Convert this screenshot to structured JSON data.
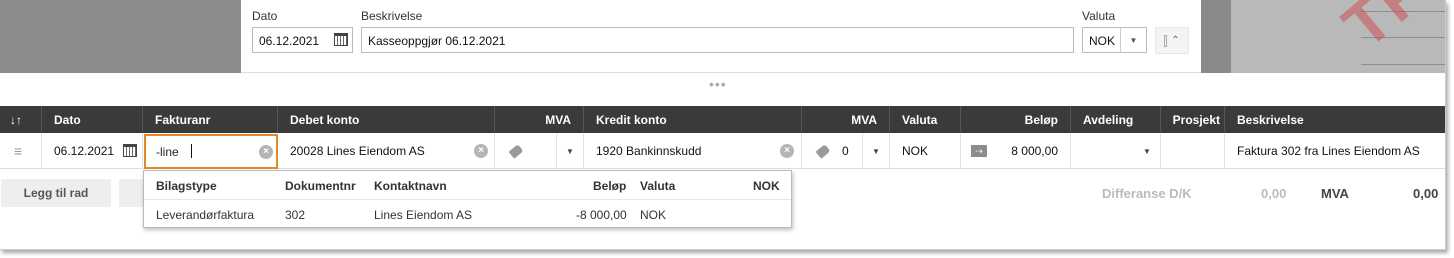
{
  "header_form": {
    "date_label": "Dato",
    "date_value": "06.12.2021",
    "description_label": "Beskrivelse",
    "description_value": "Kasseoppgjør 06.12.2021",
    "currency_label": "Valuta",
    "currency_value": "NOK"
  },
  "grid": {
    "columns": {
      "sort": "↓↑",
      "date": "Dato",
      "invoice": "Fakturanr",
      "debit_account": "Debet konto",
      "debit_vat": "MVA",
      "credit_account": "Kredit konto",
      "credit_vat": "MVA",
      "currency": "Valuta",
      "amount": "Beløp",
      "department": "Avdeling",
      "project": "Prosjekt",
      "description": "Beskrivelse"
    },
    "row": {
      "date": "06.12.2021",
      "invoice": "-line",
      "debit_account": "20028 Lines Eiendom AS",
      "credit_account": "1920 Bankinnskudd",
      "credit_vat": "0",
      "currency": "NOK",
      "amount": "8 000,00",
      "description": "Faktura 302 fra Lines Eiendom AS"
    }
  },
  "dropdown": {
    "headers": {
      "type": "Bilagstype",
      "doc": "Dokumentnr",
      "contact": "Kontaktnavn",
      "amount": "Beløp",
      "currency": "Valuta",
      "nok": "NOK"
    },
    "rows": [
      {
        "type": "Leverandørfaktura",
        "doc": "302",
        "contact": "Lines Eiendom AS",
        "amount": "-8 000,00",
        "currency": "NOK"
      }
    ]
  },
  "footer": {
    "add_row": "Legg til rad",
    "diff_label": "Differanse D/K",
    "diff_value": "0,00",
    "vat_label": "MVA",
    "vat_value": "0,00"
  },
  "icons": [
    "calendar-icon",
    "caret-down-icon",
    "collapse-icon",
    "drag-handle-icon",
    "clear-icon",
    "tag-icon",
    "arrow-right-icon"
  ],
  "colors": {
    "header_bg": "#3a3a3a",
    "focus": "#e08a2a"
  }
}
